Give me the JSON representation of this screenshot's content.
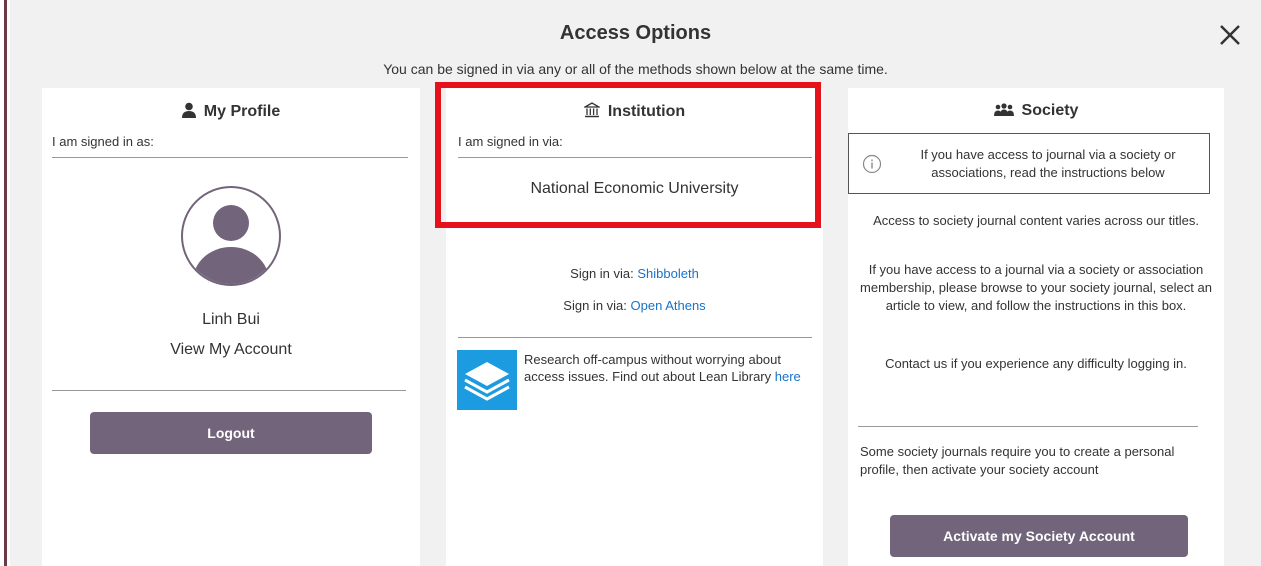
{
  "dialog": {
    "title": "Access Options",
    "subtitle": "You can be signed in via any or all of the methods shown below at the same time.",
    "close_icon": "close-icon"
  },
  "profile": {
    "heading": "My Profile",
    "heading_icon": "user-icon",
    "signed_in_label": "I am signed in as:",
    "avatar_icon": "avatar-icon",
    "user_name": "Linh Bui",
    "view_account": "View My Account",
    "logout": "Logout"
  },
  "institution": {
    "heading": "Institution",
    "heading_icon": "institution-icon",
    "signed_in_label": "I am signed in via:",
    "institution_name": "National Economic University",
    "sign_in_prefix": "Sign in via:",
    "shibboleth": "Shibboleth",
    "open_athens": "Open Athens",
    "lean_library_icon": "lean-library-icon",
    "lean_text": "Research off-campus without worrying about access issues. Find out about Lean Library",
    "lean_link": "here"
  },
  "society": {
    "heading": "Society",
    "heading_icon": "group-icon",
    "info_icon": "info-icon",
    "info_text": "If you have access to journal via a society or associations, read the instructions below",
    "para1": "Access to society journal content varies across our titles.",
    "para2": "If you have access to a journal via a society or association membership, please browse to your society journal, select an article to view, and follow the instructions in this box.",
    "para3": "Contact us if you experience any difficulty logging in.",
    "para4": "Some society journals require you to create a personal profile, then activate your society account",
    "activate": "Activate my Society Account"
  },
  "colors": {
    "button": "#72647b",
    "link": "#1a73c9",
    "highlight": "#e5121b",
    "avatar": "#72647b"
  }
}
